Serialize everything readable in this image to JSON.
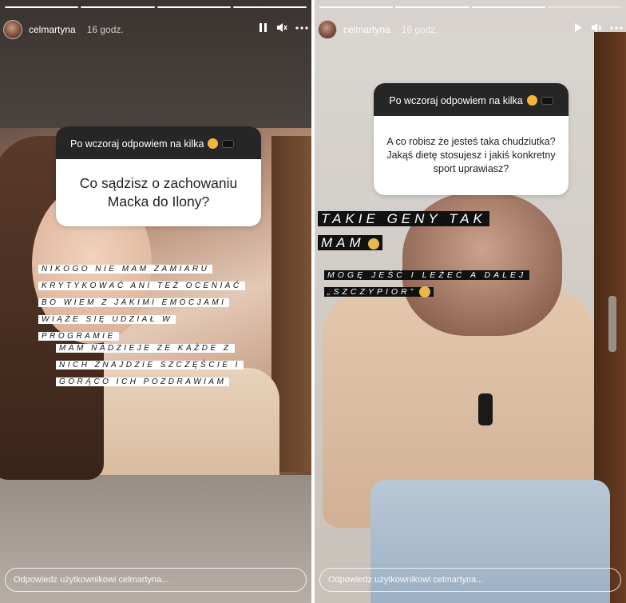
{
  "stories": [
    {
      "progress": {
        "segments": 4,
        "completed": 4
      },
      "header": {
        "username": "celmartyna",
        "time": "16 godz."
      },
      "question": {
        "title": "Po wczoraj odpowiem na kilka",
        "body": "Co sądzisz o zachowaniu Macka do Ilony?"
      },
      "answer_block_1": [
        "NIKOGO NIE MAM ZAMIARU",
        "KRYTYKOWAĆ ANI TEŻ OCENIAĆ",
        "BO WIEM Z JAKIMI EMOCJAMI",
        "WIĄŻE SIĘ UDZIAŁ W",
        "PROGRAMIE"
      ],
      "answer_block_2": [
        "MAM NADZIEJE ZE KAŻDE Z",
        "NICH ZNAJDZIE SZCZĘŚCIE I",
        "GORĄCO ICH POZDRAWIAM"
      ],
      "reply_placeholder": "Odpowiedz użytkownikowi celmartyna..."
    },
    {
      "progress": {
        "segments": 4,
        "completed": 3
      },
      "header": {
        "username": "celmartyna",
        "time": "16 godz."
      },
      "question": {
        "title": "Po wczoraj odpowiem na kilka",
        "body": "A co robisz że jesteś taka chudziutka? Jakąś dietę stosujesz i jakiś konkretny sport uprawiasz?"
      },
      "answer_big": [
        "TAKIE GENY TAK",
        "MAM"
      ],
      "answer_small": [
        "MOGĘ JEŚĆ I LEŻEĆ A DALEJ",
        "„SZCZYPIOR”"
      ],
      "reply_placeholder": "Odpowiedz użytkownikowi celmartyna..."
    }
  ],
  "icons": [
    "pause-icon",
    "mute-icon",
    "more-icon",
    "play-icon"
  ]
}
